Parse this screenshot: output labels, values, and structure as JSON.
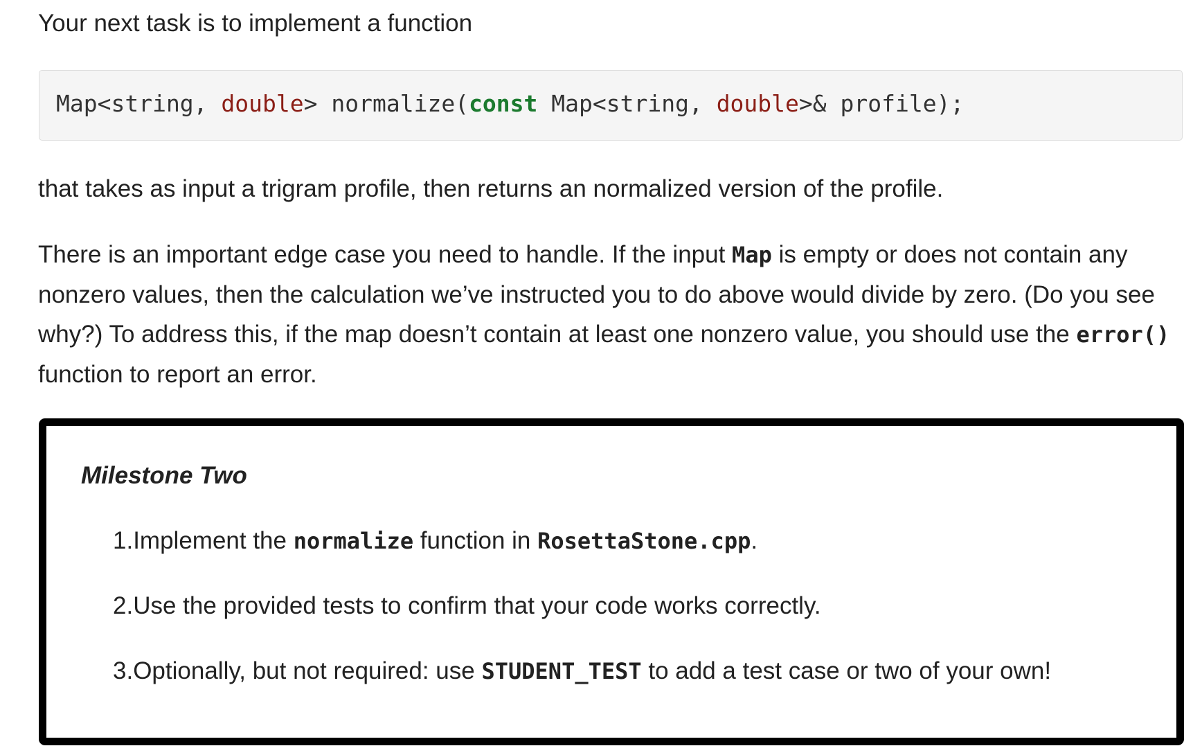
{
  "intro": "Your next task is to implement a function",
  "code": {
    "t1": "Map<string, ",
    "t2": "double",
    "t3": "> normalize(",
    "t4": "const",
    "t5": " Map<string, ",
    "t6": "double",
    "t7": ">& profile);"
  },
  "para1": "that takes as input a trigram profile, then returns an normalized version of the profile.",
  "para2": {
    "a": "There is an important edge case you need to handle. If the input ",
    "map_code": "Map",
    "b": " is empty or does not contain any nonzero values, then the calculation we’ve instructed you to do above would divide by zero. (Do you see why?) To address this, if the map doesn’t contain at least one nonzero value, you should use the ",
    "error_code": "error()",
    "c": " function to report an error."
  },
  "milestone": {
    "title": "Milestone Two",
    "items": [
      {
        "num": "1. ",
        "a": "Implement the ",
        "code1": "normalize",
        "b": " function in ",
        "code2": "RosettaStone.cpp",
        "c": "."
      },
      {
        "num": "2. ",
        "a": "Use the provided tests to confirm that your code works correctly."
      },
      {
        "num": "3. ",
        "a": "Optionally, but not required: use ",
        "code1": "STUDENT_TEST",
        "b": " to add a test case or two of your own!"
      }
    ]
  },
  "colors": {
    "code_type": "#8b1e16",
    "code_keyword": "#1b7a2e",
    "code_background": "#f5f5f5",
    "milestone_border": "#000000"
  }
}
